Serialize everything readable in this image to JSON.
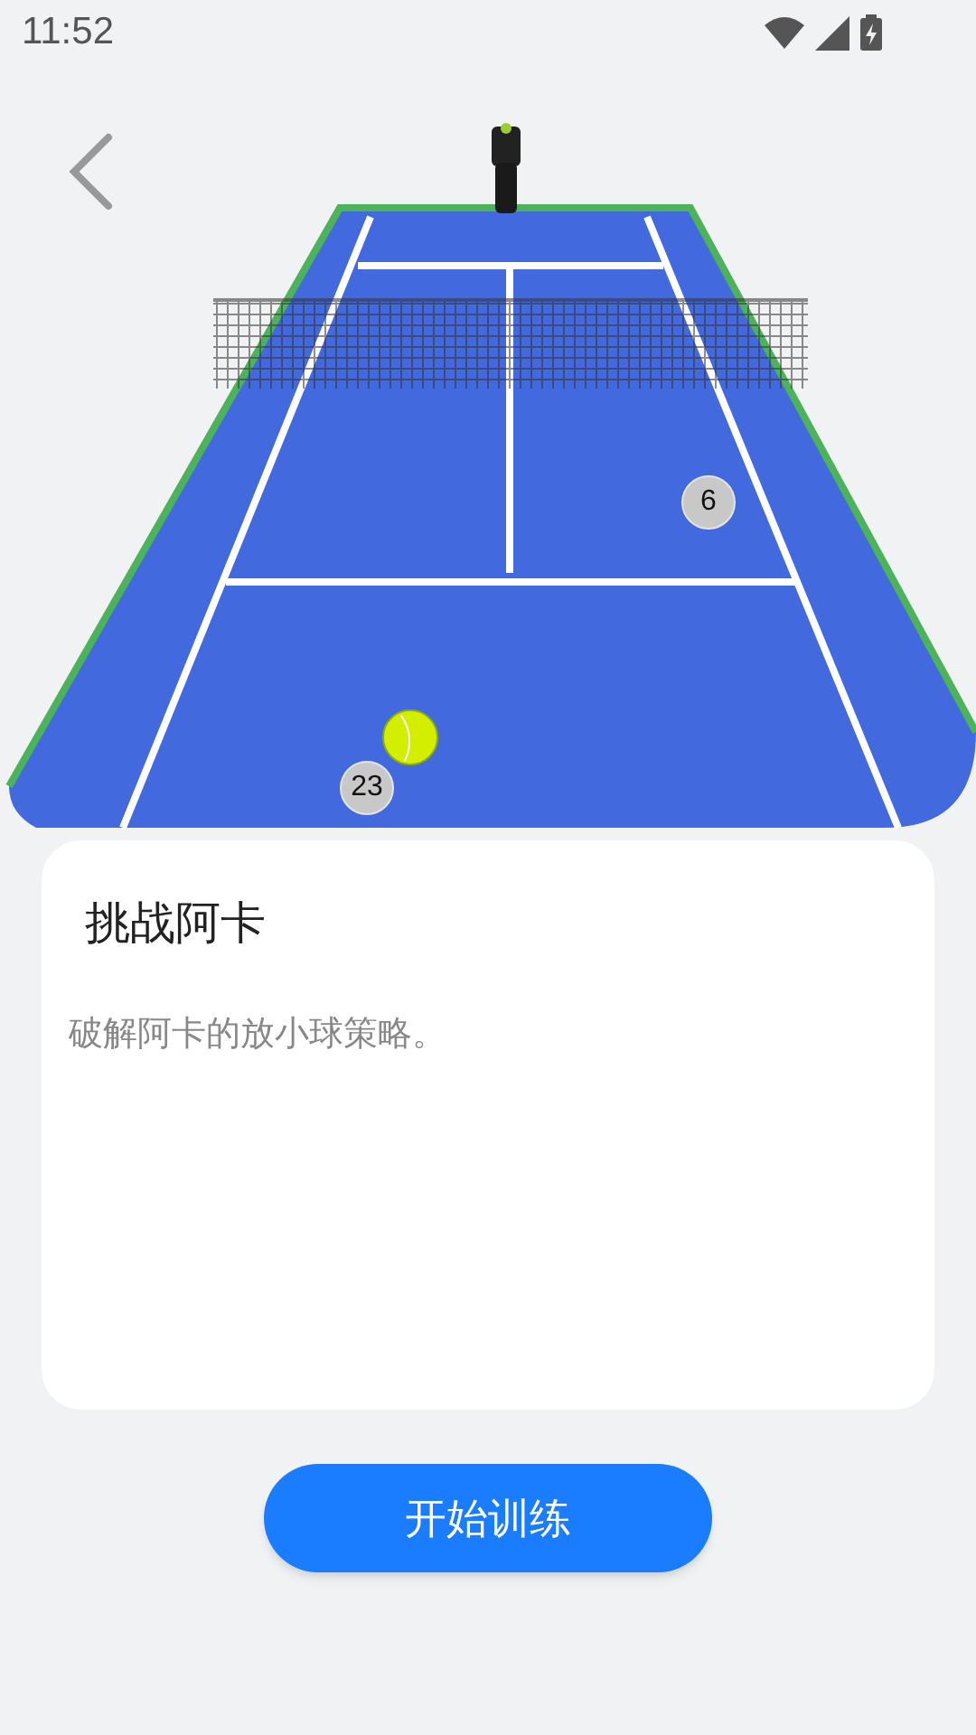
{
  "status_bar": {
    "time": "11:52"
  },
  "court": {
    "balls": [
      {
        "label": "6"
      },
      {
        "label": "23"
      }
    ]
  },
  "card": {
    "title": "挑战阿卡",
    "description": "破解阿卡的放小球策略。"
  },
  "start_button": {
    "label": "开始训练"
  }
}
